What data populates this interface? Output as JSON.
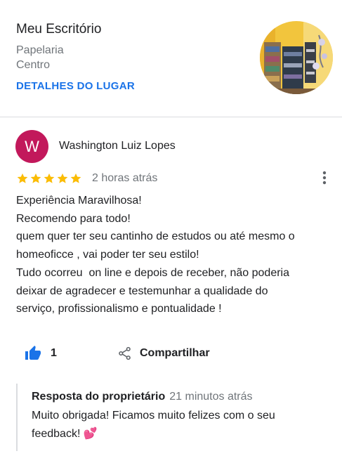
{
  "place": {
    "name": "Meu Escritório",
    "category": "Papelaria",
    "area": "Centro",
    "details_link": "DETALHES DO LUGAR"
  },
  "review": {
    "avatar_initial": "W",
    "author": "Washington Luiz Lopes",
    "rating": 5,
    "time_ago": "2 horas atrás",
    "text_lines": [
      "Experiência Maravilhosa!",
      "Recomendo para todo!",
      "quem quer ter seu cantinho de estudos ou até mesmo o",
      "homeoficce , vai poder ter seu estilo!",
      "Tudo ocorreu  on line e depois de receber, não poderia",
      "deixar de agradecer e testemunhar a qualidade do",
      "serviço, profissionalismo e pontualidade !"
    ],
    "like_count": "1",
    "share_label": "Compartilhar"
  },
  "owner_reply": {
    "label": "Resposta do proprietário",
    "time_ago": "21 minutos atrás",
    "text": "Muito obrigada! Ficamos muito felizes com o seu feedback! 💕"
  },
  "icons": {
    "stars": "star-icon",
    "more": "more-vert-icon",
    "like": "thumb-up-icon",
    "share": "share-icon"
  },
  "colors": {
    "link": "#1a73e8",
    "star": "#fbbc04",
    "avatar_bg": "#c2185b",
    "secondary_text": "#70757a",
    "like_icon": "#1a73e8"
  }
}
